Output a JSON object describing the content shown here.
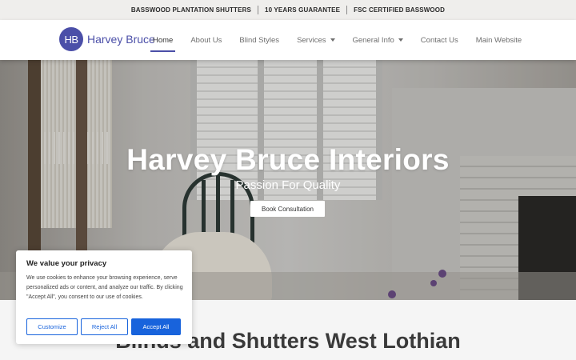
{
  "topbar": {
    "items": [
      "BASSWOOD PLANTATION SHUTTERS",
      "10 YEARS GUARANTEE",
      "FSC CERTIFIED BASSWOOD"
    ]
  },
  "header": {
    "logo_monogram": "HB",
    "logo_text": "Harvey Bruce",
    "nav": [
      {
        "label": "Home",
        "active": true
      },
      {
        "label": "About Us"
      },
      {
        "label": "Blind Styles"
      },
      {
        "label": "Services",
        "dropdown": true
      },
      {
        "label": "General Info",
        "dropdown": true
      },
      {
        "label": "Contact Us"
      },
      {
        "label": "Main Website"
      }
    ]
  },
  "hero": {
    "title": "Harvey Bruce Interiors",
    "subtitle": "Passion For Quality",
    "button_label": "Book Consultation"
  },
  "section": {
    "title": "Blinds and Shutters West Lothian"
  },
  "cookie": {
    "title": "We value your privacy",
    "text": "We use cookies to enhance your browsing experience, serve personalized ads or content, and analyze our traffic. By clicking \"Accept All\", you consent to our use of cookies.",
    "customize_label": "Customize",
    "reject_label": "Reject All",
    "accept_label": "Accept All"
  },
  "colors": {
    "brand": "#4b4fa8",
    "cookie_accent": "#1863dc",
    "topbar_bg": "#efeeec"
  }
}
